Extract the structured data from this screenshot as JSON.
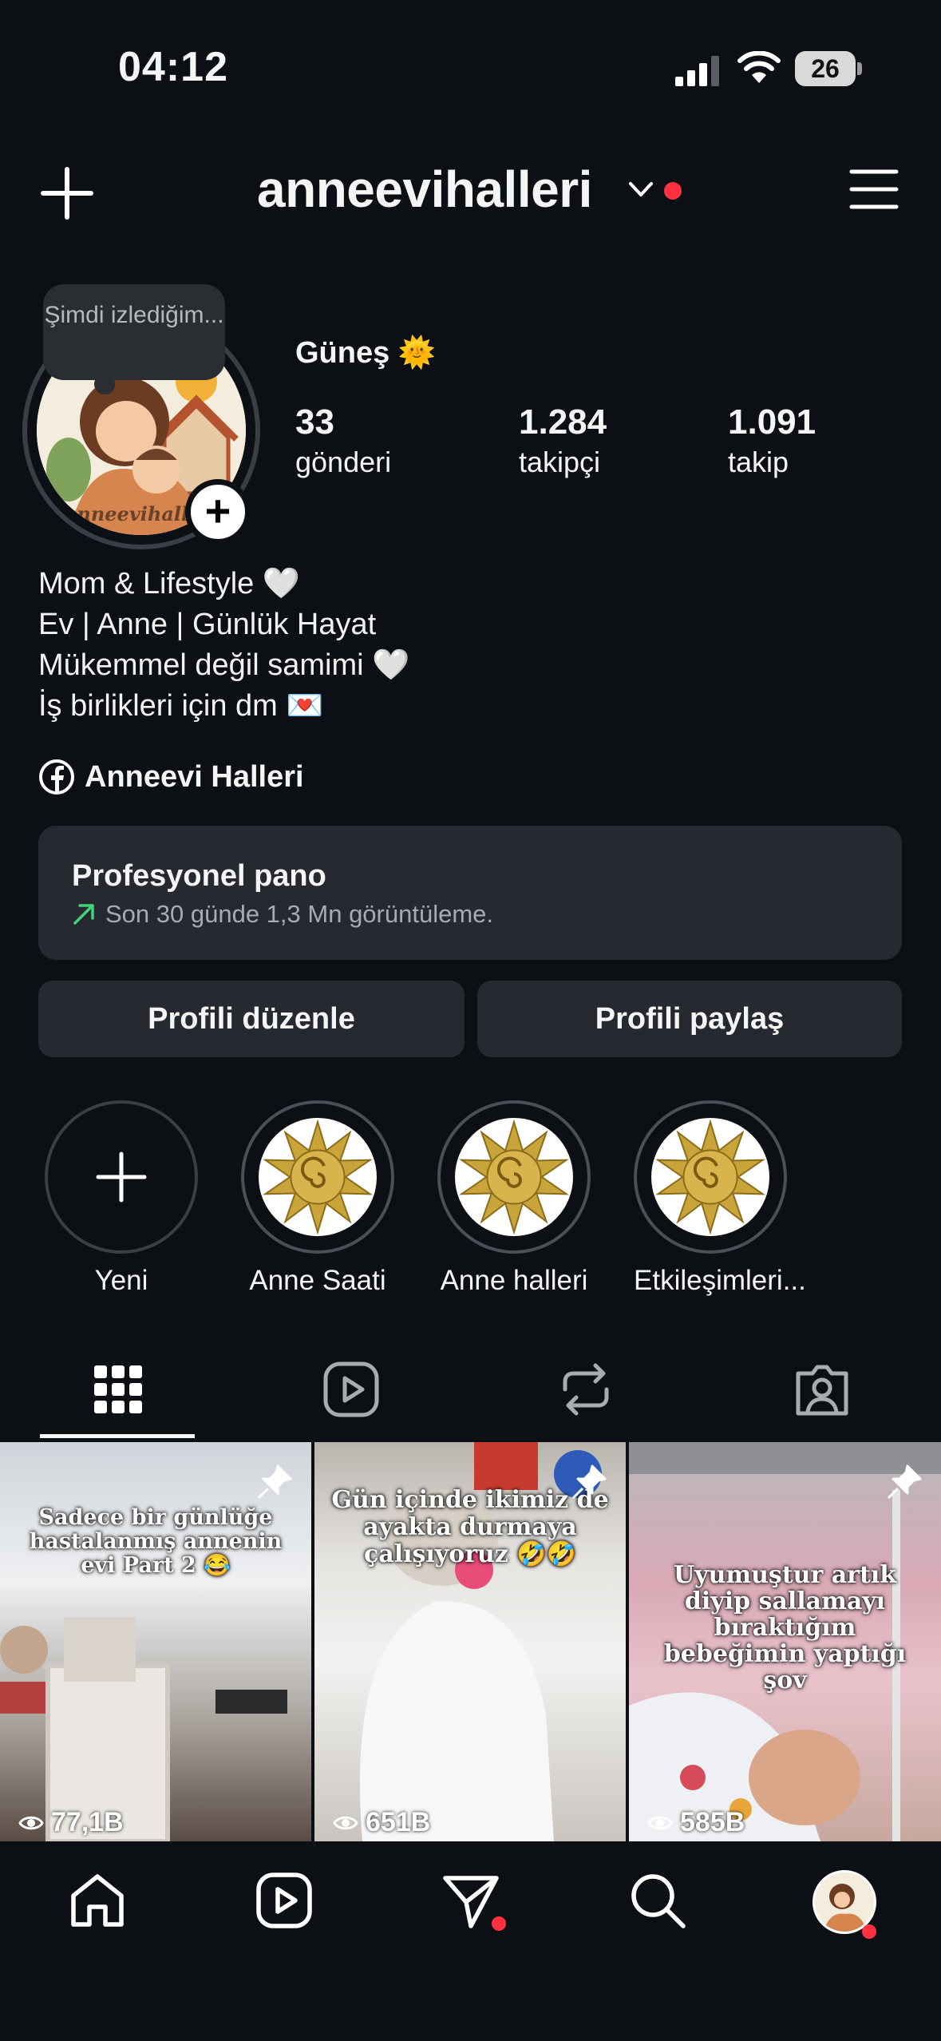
{
  "status_bar": {
    "time": "04:12",
    "battery": "26"
  },
  "header": {
    "username": "anneevihalleri"
  },
  "note": {
    "text": "Şimdi izlediğim..."
  },
  "avatar": {
    "logo_text": "anneevihalleri"
  },
  "profile": {
    "display_name": "Güneş 🌞",
    "stats": [
      {
        "value": "33",
        "label": "gönderi"
      },
      {
        "value": "1.284",
        "label": "takipçi"
      },
      {
        "value": "1.091",
        "label": "takip"
      }
    ],
    "bio": [
      "Mom & Lifestyle 🤍",
      "Ev | Anne | Günlük Hayat",
      "Mükemmel değil samimi 🤍",
      "İş birlikleri için dm 💌"
    ],
    "facebook_link": "Anneevi Halleri"
  },
  "dashboard": {
    "title": "Profesyonel pano",
    "subtitle": "Son 30 günde 1,3 Mn görüntüleme."
  },
  "buttons": {
    "edit": "Profili düzenle",
    "share": "Profili paylaş"
  },
  "highlights": [
    {
      "label": "Yeni"
    },
    {
      "label": "Anne Saati"
    },
    {
      "label": "Anne halleri"
    },
    {
      "label": "Etkileşimleri..."
    }
  ],
  "tabs": [
    "grid-icon",
    "reels-icon",
    "reposts-icon",
    "tagged-icon"
  ],
  "posts": [
    {
      "caption": "Sadece bir günlüğe hastalanmış annenin evi Part 2 😂",
      "views": "77,1B"
    },
    {
      "caption": "Gün içinde ikimiz de ayakta durmaya çalışıyoruz 🤣🤣",
      "views": "651B"
    },
    {
      "caption": "Uyumuştur artık diyip sallamayı bıraktığım bebeğimin  yaptığı şov",
      "views": "585B"
    }
  ],
  "colors": {
    "background": "#0c1014",
    "card": "#262a30",
    "notification": "#ff3040",
    "trend": "#3fd37a"
  }
}
